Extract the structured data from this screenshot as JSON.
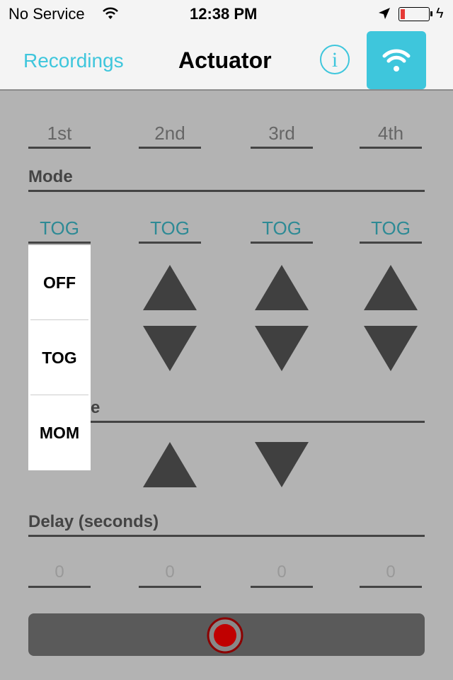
{
  "status_bar": {
    "carrier": "No Service",
    "time": "12:38 PM",
    "battery_color": "#e53935"
  },
  "nav": {
    "back_label": "Recordings",
    "title": "Actuator",
    "accent": "#3ec6dc",
    "info_icon": "info-icon",
    "wifi_icon": "wifi-icon"
  },
  "channels": [
    "1st",
    "2nd",
    "3rd",
    "4th"
  ],
  "mode": {
    "label": "Mode",
    "values": [
      "TOG",
      "TOG",
      "TOG",
      "TOG"
    ]
  },
  "dropdown": {
    "options": [
      "OFF",
      "TOG",
      "MOM"
    ]
  },
  "hidden_section": {
    "label_visible": "e"
  },
  "delay": {
    "label": "Delay (seconds)",
    "values": [
      "0",
      "0",
      "0",
      "0"
    ]
  },
  "record": {
    "icon": "record-icon",
    "color": "#c00000"
  }
}
